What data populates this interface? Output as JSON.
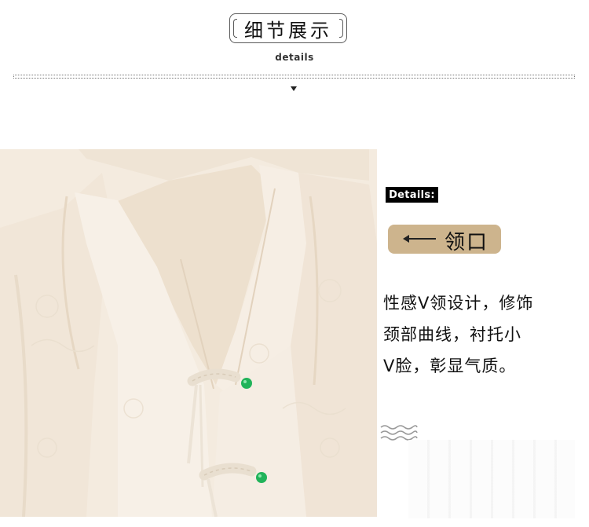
{
  "header": {
    "title": "细节展示",
    "subtitle": "details"
  },
  "panel": {
    "tag": "Details:",
    "feature_label": "领口",
    "description_lines": [
      "性感V领设计，修饰",
      "颈部曲线，衬托小",
      "V脸，彰显气质。"
    ]
  },
  "colors": {
    "pill": "#cdb48d",
    "fabric": "#f3e8da",
    "bead": "#21b35a"
  },
  "icons": {
    "arrow": "down-triangle-icon",
    "pointer": "left-arrow-icon",
    "waves": "wave-lines-icon"
  }
}
